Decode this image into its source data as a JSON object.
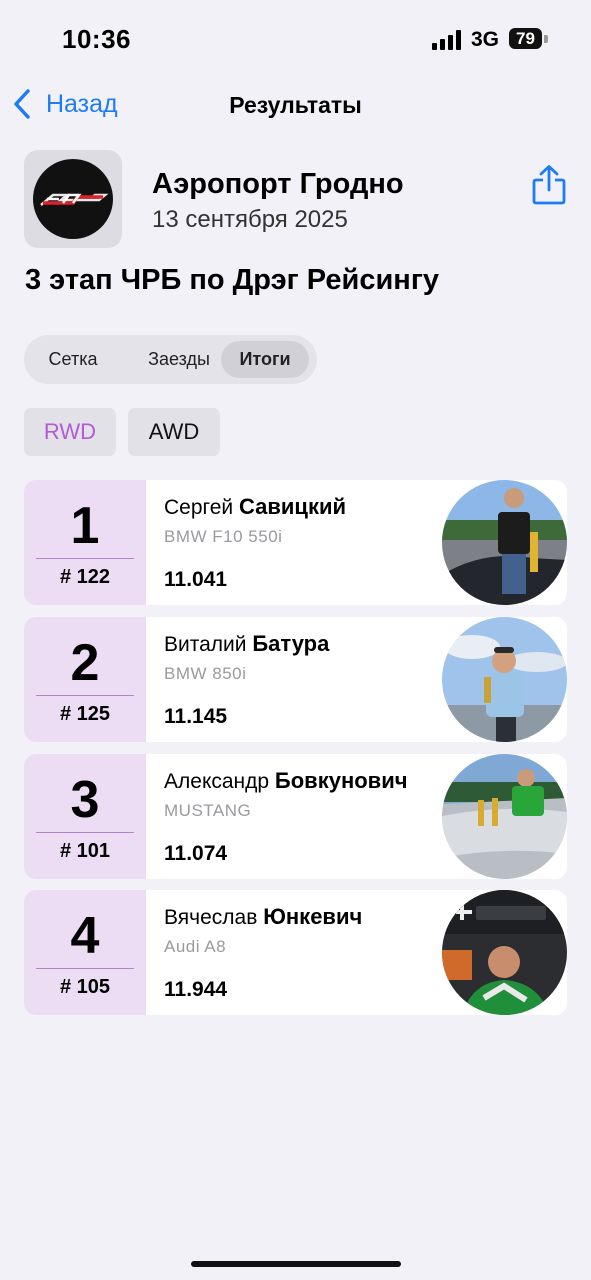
{
  "status_bar": {
    "time": "10:36",
    "network": "3G",
    "battery": "79"
  },
  "nav": {
    "back_label": "Назад",
    "title": "Результаты"
  },
  "event": {
    "title": "Аэропорт Гродно",
    "date": "13 сентября 2025",
    "stage": "3 этап ЧРБ по Дрэг Рейсингу",
    "logo_text": "ЧРБ",
    "logo_icon": "event-logo"
  },
  "tabs": [
    "Сетка",
    "Заезды",
    "Итоги"
  ],
  "active_tab": "Итоги",
  "categories": [
    "RWD",
    "AWD"
  ],
  "active_category": "RWD",
  "results": [
    {
      "position": "1",
      "bib": "# 122",
      "first_name": "Сергей",
      "last_name": "Савицкий",
      "car": "BMW F10 550i",
      "time": "11.041"
    },
    {
      "position": "2",
      "bib": "# 125",
      "first_name": "Виталий",
      "last_name": "Батура",
      "car": "BMW 850i",
      "time": "11.145"
    },
    {
      "position": "3",
      "bib": "# 101",
      "first_name": "Александр",
      "last_name": "Бовкунович",
      "car": "MUSTANG",
      "time": "11.074"
    },
    {
      "position": "4",
      "bib": "# 105",
      "first_name": "Вячеслав",
      "last_name": "Юнкевич",
      "car": "Audi A8",
      "time": "11.944"
    }
  ],
  "colors": {
    "accent": "#1e7cf2",
    "position_bg": "#ecdcf4",
    "active_category": "#b35ad6",
    "background": "#f2f1f7"
  }
}
